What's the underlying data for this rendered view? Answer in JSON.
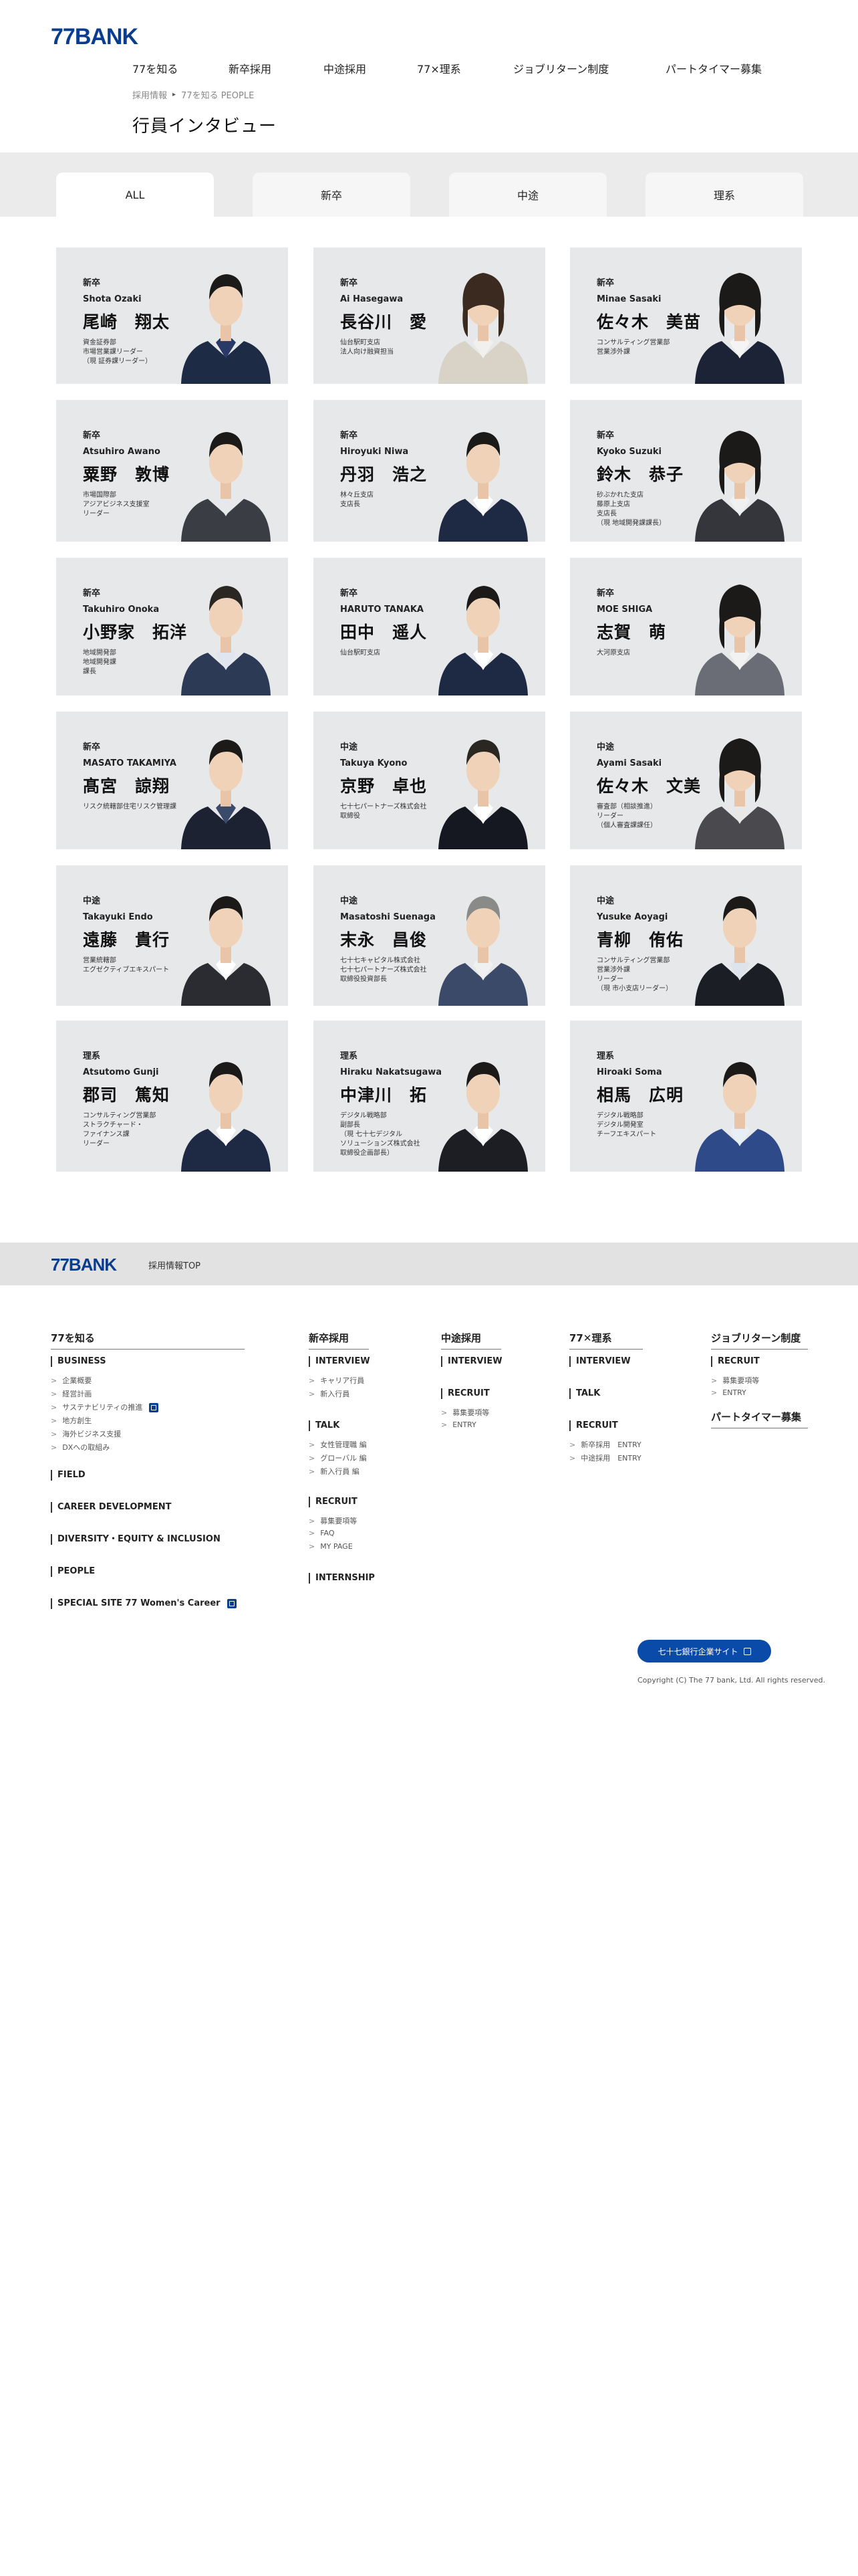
{
  "header": {
    "logo_num": "77",
    "logo_text": "BANK",
    "nav": [
      "77を知る",
      "新卒採用",
      "中途採用",
      "77×理系",
      "ジョブリターン制度",
      "パートタイマー募集"
    ],
    "breadcrumb": [
      "採用情報",
      "77を知る PEOPLE"
    ],
    "page_title": "行員インタビュー"
  },
  "tabs": [
    "ALL",
    "新卒",
    "中途",
    "理系"
  ],
  "cards": [
    {
      "cat": "新卒",
      "roman": "Shota Ozaki",
      "kanji": "尾崎　翔太",
      "dept": "資金証券部\n市場営業課リーダー\n（現 証券課リーダー）",
      "suit": "#1e2b45",
      "shirt": "#2a3a66",
      "hair": "#1c1a18",
      "female": false
    },
    {
      "cat": "新卒",
      "roman": "Ai Hasegawa",
      "kanji": "長谷川　愛",
      "dept": "仙台駅町支店\n法人向け融資担当",
      "suit": "#d9d2c6",
      "shirt": "#f2f0ec",
      "hair": "#3a2a20",
      "female": true
    },
    {
      "cat": "新卒",
      "roman": "Minae Sasaki",
      "kanji": "佐々木　美苗",
      "dept": "コンサルティング営業部\n営業渉外課",
      "suit": "#1c2336",
      "shirt": "#f4f4f4",
      "hair": "#1c1a18",
      "female": true
    },
    {
      "cat": "新卒",
      "roman": "Atsuhiro Awano",
      "kanji": "粟野　敦博",
      "dept": "市場国際部\nアジアビジネス支援室\nリーダー",
      "suit": "#3a3d44",
      "shirt": "#e6e8ec",
      "hair": "#1c1a18",
      "female": false
    },
    {
      "cat": "新卒",
      "roman": "Hiroyuki Niwa",
      "kanji": "丹羽　浩之",
      "dept": "林々丘支店\n支店長",
      "suit": "#1e2a44",
      "shirt": "#ffffff",
      "hair": "#1c1a18",
      "female": false
    },
    {
      "cat": "新卒",
      "roman": "Kyoko Suzuki",
      "kanji": "鈴木　恭子",
      "dept": "砂ぶかれた支店\n藤原上支店\n支店長\n（現 地域開発課課長）",
      "suit": "#34363c",
      "shirt": "#f0f0f0",
      "hair": "#1c1a18",
      "female": true
    },
    {
      "cat": "新卒",
      "roman": "Takuhiro Onoka",
      "kanji": "小野家　拓洋",
      "dept": "地域開発部\n地域開発課\n課長",
      "suit": "#2c3a56",
      "shirt": "#dfe6f0",
      "hair": "#2a2622",
      "female": false
    },
    {
      "cat": "新卒",
      "roman": "HARUTO TANAKA",
      "kanji": "田中　遥人",
      "dept": "仙台駅町支店",
      "suit": "#1e2a44",
      "shirt": "#ffffff",
      "hair": "#1c1a18",
      "female": false
    },
    {
      "cat": "新卒",
      "roman": "MOE SHIGA",
      "kanji": "志賀　萌",
      "dept": "大河原支店",
      "suit": "#6a6d75",
      "shirt": "#f2f2f2",
      "hair": "#1c1a18",
      "female": true
    },
    {
      "cat": "新卒",
      "roman": "MASATO TAKAMIYA",
      "kanji": "髙宮　諒翔",
      "dept": "リスク統轄部住宅リスク管理課",
      "suit": "#1c2232",
      "shirt": "#3a4a6a",
      "hair": "#1c1a18",
      "female": false
    },
    {
      "cat": "中途",
      "roman": "Takuya Kyono",
      "kanji": "京野　卓也",
      "dept": "七十七パートナーズ株式会社\n取締役",
      "suit": "#151820",
      "shirt": "#ffffff",
      "hair": "#2a2622",
      "female": false
    },
    {
      "cat": "中途",
      "roman": "Ayami Sasaki",
      "kanji": "佐々木　文美",
      "dept": "審査部（相談推進）\nリーダー\n（個人審査課課任）",
      "suit": "#4a4a4e",
      "shirt": "#e8e8e8",
      "hair": "#1c1a18",
      "female": true
    },
    {
      "cat": "中途",
      "roman": "Takayuki Endo",
      "kanji": "遠藤　貴行",
      "dept": "営業統轄部\nエグゼクティブエキスパート",
      "suit": "#2a2c32",
      "shirt": "#ffffff",
      "hair": "#1c1a18",
      "female": false
    },
    {
      "cat": "中途",
      "roman": "Masatoshi Suenaga",
      "kanji": "末永　昌俊",
      "dept": "七十七キャピタル株式会社\n七十七パートナーズ株式会社\n取締役投資部長",
      "suit": "#3a4a68",
      "shirt": "#f0f0f0",
      "hair": "#8a8a88",
      "female": false
    },
    {
      "cat": "中途",
      "roman": "Yusuke Aoyagi",
      "kanji": "青柳　侑佑",
      "dept": "コンサルティング営業部\n営業渉外課\nリーダー\n（現 市小支店リーダー）",
      "suit": "#1c1e26",
      "shirt": "#dfe4ec",
      "hair": "#1c1a18",
      "female": false
    },
    {
      "cat": "理系",
      "roman": "Atsutomo Gunji",
      "kanji": "郡司　篤知",
      "dept": "コンサルティング営業部\nストラクチャード・\nファイナンス課\nリーダー",
      "suit": "#1e2a44",
      "shirt": "#ffffff",
      "hair": "#1c1a18",
      "female": false
    },
    {
      "cat": "理系",
      "roman": "Hiraku Nakatsugawa",
      "kanji": "中津川　拓",
      "dept": "デジタル戦略部\n副部長\n（現 七十七デジタル\nソリューションズ株式会社\n取締役企画部長）",
      "suit": "#1c1e24",
      "shirt": "#ffffff",
      "hair": "#1c1a18",
      "female": false
    },
    {
      "cat": "理系",
      "roman": "Hiroaki Soma",
      "kanji": "相馬　広明",
      "dept": "デジタル戦略部\nデジタル開発室\nチーフエキスパート",
      "suit": "#2e4a88",
      "shirt": "#e8eef6",
      "hair": "#1c1a18",
      "female": false
    }
  ],
  "footer": {
    "logo_num": "77",
    "logo_text": "BANK",
    "top_link": "採用情報TOP",
    "col1": {
      "head": "77を知る",
      "business": "BUSINESS",
      "business_links": [
        "企業概要",
        "経営計画",
        "サステナビリティの推進",
        "地方創生",
        "海外ビジネス支援",
        "DXへの取組み"
      ],
      "field": "FIELD",
      "career": "CAREER DEVELOPMENT",
      "diversity": "DIVERSITY・EQUITY & INCLUSION",
      "people": "PEOPLE",
      "special": "SPECIAL SITE 77 Women's Career"
    },
    "col2": {
      "head": "新卒採用",
      "interview": "INTERVIEW",
      "interview_links": [
        "キャリア行員",
        "新入行員"
      ],
      "talk": "TALK",
      "talk_links": [
        "女性管理職 編",
        "グローバル 編",
        "新入行員 編"
      ],
      "recruit": "RECRUIT",
      "recruit_links": [
        "募集要項等",
        "FAQ",
        "MY PAGE"
      ],
      "internship": "INTERNSHIP"
    },
    "col3": {
      "head": "中途採用",
      "interview": "INTERVIEW",
      "recruit": "RECRUIT",
      "recruit_links": [
        "募集要項等",
        "ENTRY"
      ]
    },
    "col4": {
      "head": "77✕理系",
      "interview": "INTERVIEW",
      "talk": "TALK",
      "recruit": "RECRUIT",
      "recruit_links": [
        "新卒採用　ENTRY",
        "中途採用　ENTRY"
      ]
    },
    "col5": {
      "head": "ジョブリターン制度",
      "recruit": "RECRUIT",
      "recruit_links": [
        "募集要項等",
        "ENTRY"
      ],
      "head2": "パートタイマー募集"
    },
    "corp_button": "七十七銀行企業サイト",
    "copyright": "Copyright (C) The 77 bank, Ltd. All rights reserved."
  }
}
